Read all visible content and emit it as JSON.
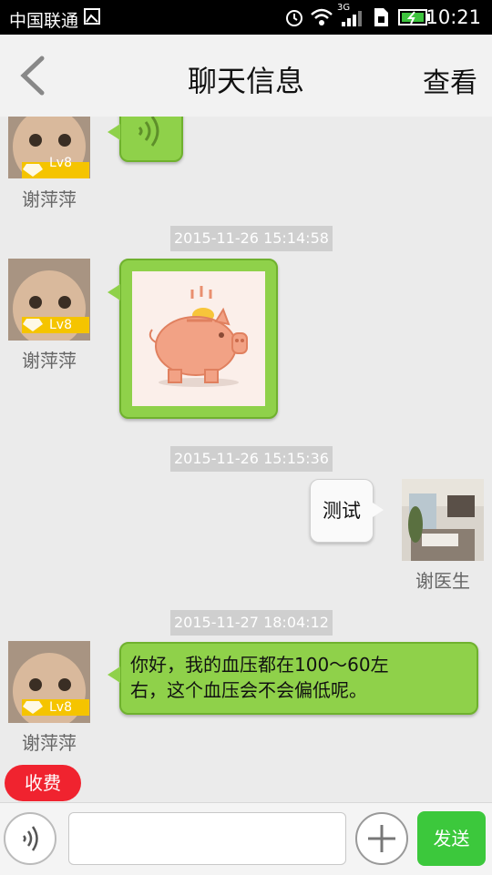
{
  "status_bar": {
    "carrier": "中国联通",
    "network": "3G",
    "time": "10:21"
  },
  "header": {
    "title": "聊天信息",
    "right_action": "查看"
  },
  "messages": [
    {
      "sender": "谢萍萍",
      "type": "voice",
      "level": "Lv8"
    },
    {
      "timestamp": "2015-11-26 15:14:58",
      "sender": "谢萍萍",
      "type": "image",
      "level": "Lv8"
    },
    {
      "timestamp": "2015-11-26 15:15:36",
      "sender": "谢医生",
      "type": "text",
      "text": "测试"
    },
    {
      "timestamp": "2015-11-27 18:04:12",
      "sender": "谢萍萍",
      "type": "text",
      "level": "Lv8",
      "text_line1": "你好，我的血压都在100～60左",
      "text_line2": "右，这个血压会不会偏低呢。"
    }
  ],
  "fee_button": "收费",
  "input_bar": {
    "placeholder": "",
    "send_label": "发送"
  },
  "colors": {
    "bubble_green": "#8fd14a",
    "send_green": "#3cc83c",
    "fee_red": "#f0232f",
    "level_badge": "#f5c400"
  }
}
